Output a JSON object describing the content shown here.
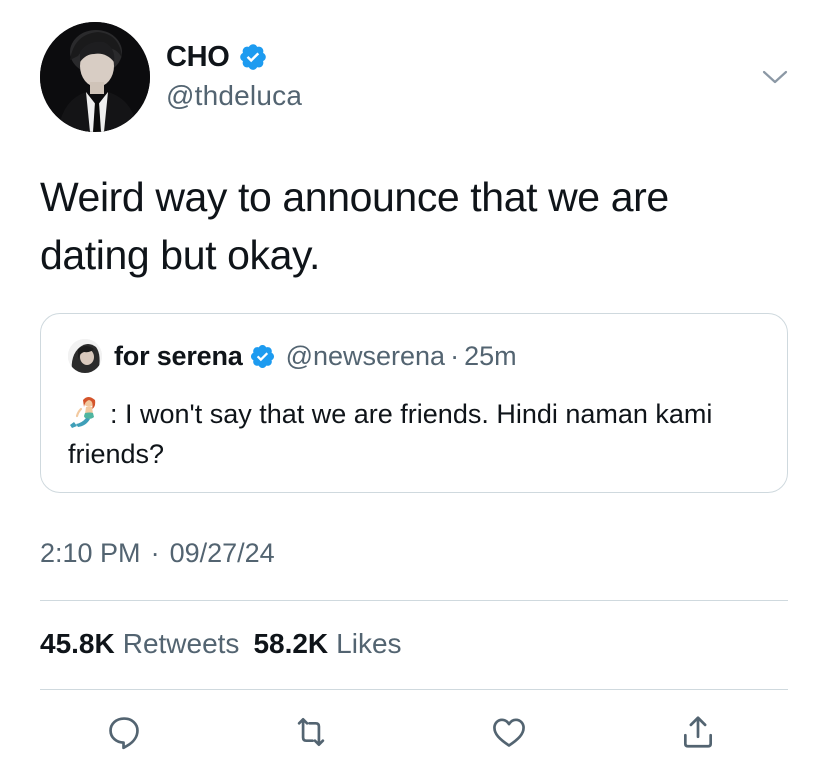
{
  "author": {
    "display_name": "CHO",
    "handle": "@thdeluca",
    "verified": true
  },
  "tweet": {
    "text": "Weird way to announce that we are dating but okay."
  },
  "quoted_tweet": {
    "display_name": "for serena",
    "handle": "@newserena",
    "separator": "·",
    "time": "25m",
    "emoji": "mermaid",
    "text": ": I won't say that we are friends. Hindi naman kami friends?"
  },
  "meta": {
    "time": "2:10 PM",
    "separator": "·",
    "date": "09/27/24"
  },
  "stats": {
    "retweets_count": "45.8K",
    "retweets_label": "Retweets",
    "likes_count": "58.2K",
    "likes_label": "Likes"
  },
  "colors": {
    "verified": "#1d9bf0",
    "secondary_text": "#536471",
    "border": "#cfd9de"
  },
  "icons": {
    "more": "chevron-down-icon",
    "reply": "reply-icon",
    "retweet": "retweet-icon",
    "like": "heart-icon",
    "share": "share-icon"
  }
}
